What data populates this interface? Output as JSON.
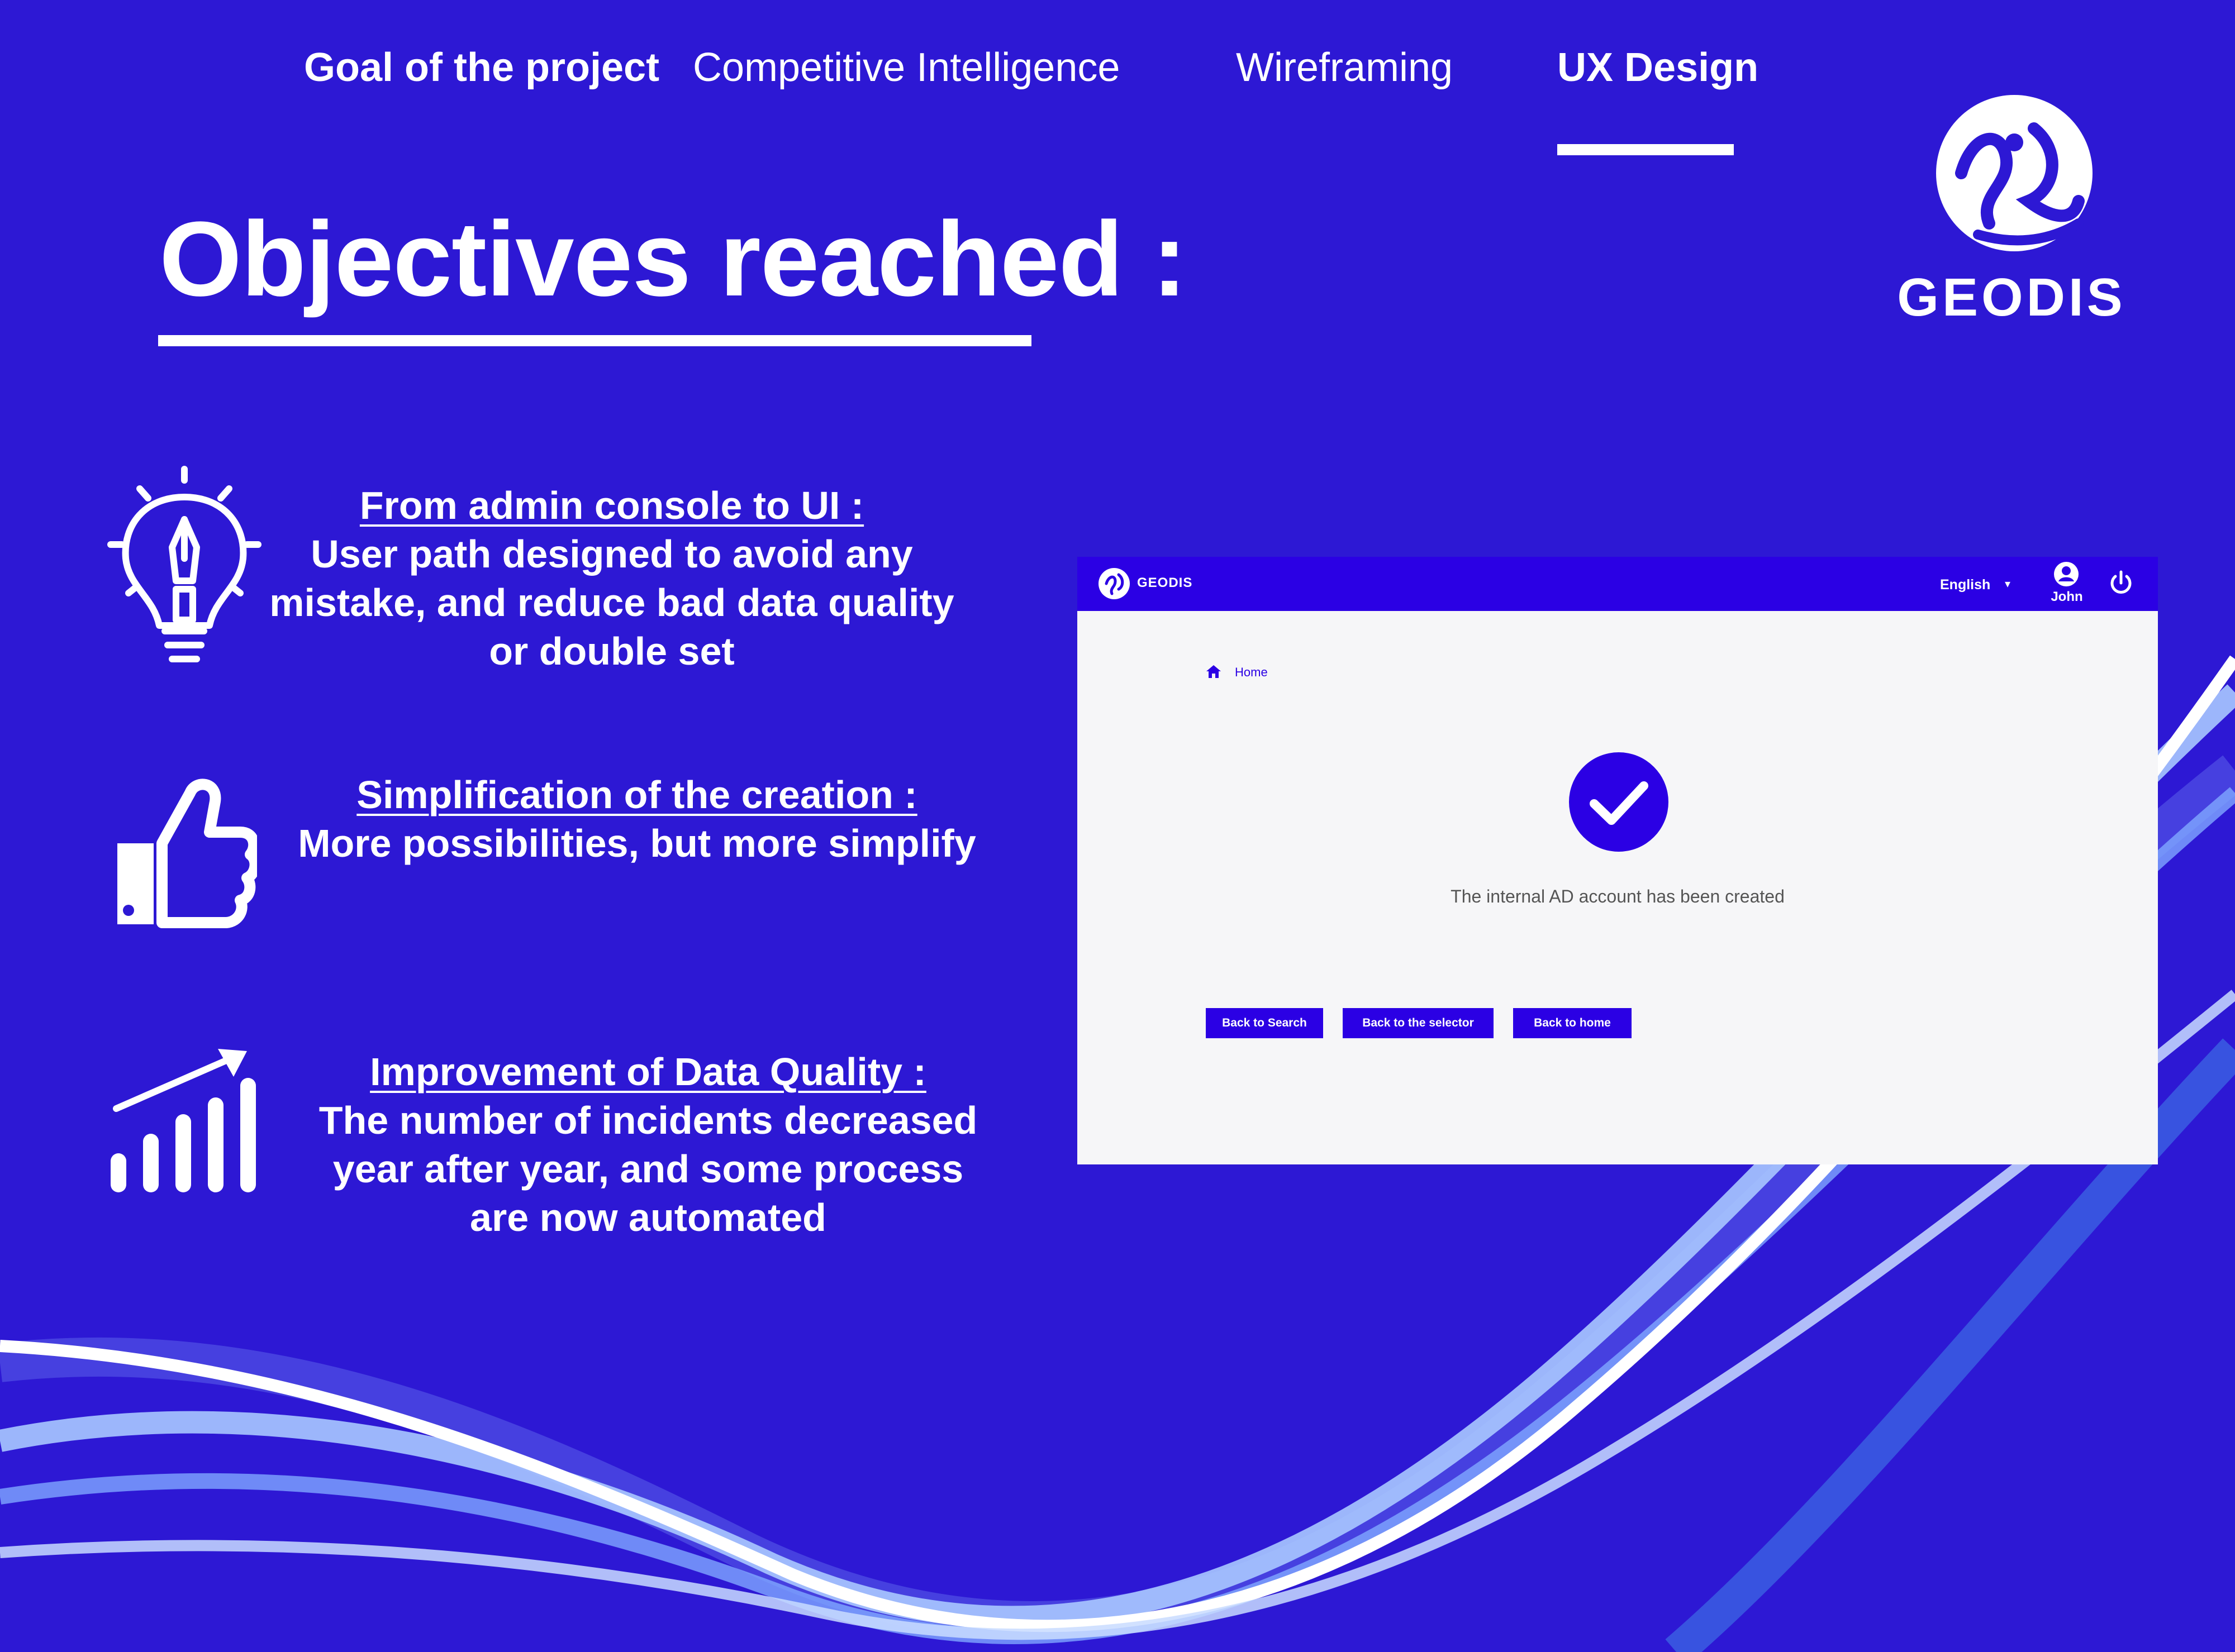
{
  "nav": {
    "tabs": [
      {
        "label": "Goal of the project"
      },
      {
        "label": "Competitive Intelligence"
      },
      {
        "label": "Wireframing"
      },
      {
        "label": "UX Design"
      }
    ],
    "active_tab": "UX Design"
  },
  "page": {
    "title": "Objectives reached :"
  },
  "brand": {
    "name": "GEODIS",
    "logo_icon": "geodis-logo-icon"
  },
  "objectives": [
    {
      "icon": "lightbulb-pen-icon",
      "heading": "From admin console to UI :",
      "lines": [
        "User path designed to avoid any",
        "mistake, and reduce bad data quality",
        "or double set"
      ]
    },
    {
      "icon": "thumbs-up-icon",
      "heading": "Simplification of the creation :",
      "lines": [
        "More possibilities, but more simplify"
      ]
    },
    {
      "icon": "growth-chart-icon",
      "heading": "Improvement of Data Quality :",
      "lines": [
        "The number of incidents decreased",
        "year after year, and some process",
        "are now automated"
      ]
    }
  ],
  "app": {
    "header": {
      "logo_text": "GEODIS",
      "language": "English",
      "user_name": "John"
    },
    "breadcrumb": {
      "home": "Home"
    },
    "success_message": "The internal AD account has been created",
    "buttons": {
      "back_to_search": "Back to Search",
      "back_to_selector": "Back to the selector",
      "back_to_home": "Back to home"
    }
  },
  "colors": {
    "background": "#2d18d4",
    "app_accent": "#2b00e4",
    "text_light": "#ffffff"
  }
}
